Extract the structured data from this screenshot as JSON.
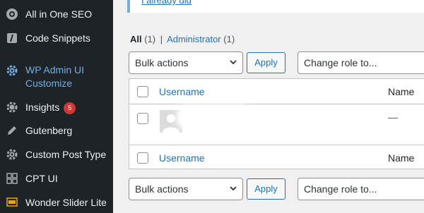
{
  "sidebar": {
    "items": [
      {
        "label": "All in One SEO",
        "icon": "aioseo-gear-icon"
      },
      {
        "label": "Code Snippets",
        "icon": "code-snippets-icon"
      },
      {
        "label": "WP Admin UI Customize",
        "icon": "gear-icon",
        "active": true
      },
      {
        "label": "Insights",
        "icon": "insights-gear-icon",
        "badge": "5"
      },
      {
        "label": "Gutenberg",
        "icon": "pencil-icon"
      },
      {
        "label": "Custom Post Type",
        "icon": "gear-icon"
      },
      {
        "label": "CPT UI",
        "icon": "grid-icon"
      },
      {
        "label": "Wonder Slider Lite",
        "icon": "slider-icon"
      }
    ]
  },
  "notice": {
    "link_text": "I already did"
  },
  "views": {
    "all_label": "All",
    "all_count": "(1)",
    "separator": "|",
    "admin_label": "Administrator",
    "admin_count": "(1)"
  },
  "top_nav": {
    "bulk_actions": "Bulk actions",
    "apply": "Apply",
    "change_role": "Change role to..."
  },
  "bottom_nav": {
    "bulk_actions": "Bulk actions",
    "apply": "Apply",
    "change_role": "Change role to..."
  },
  "table": {
    "header": {
      "username": "Username",
      "name": "Name"
    },
    "footer": {
      "username": "Username",
      "name": "Name"
    },
    "rows": [
      {
        "name": "—"
      }
    ]
  },
  "colors": {
    "sidebar_bg": "#1d2327",
    "accent": "#2271b1",
    "active_menu": "#72aee6",
    "badge": "#d63638"
  }
}
